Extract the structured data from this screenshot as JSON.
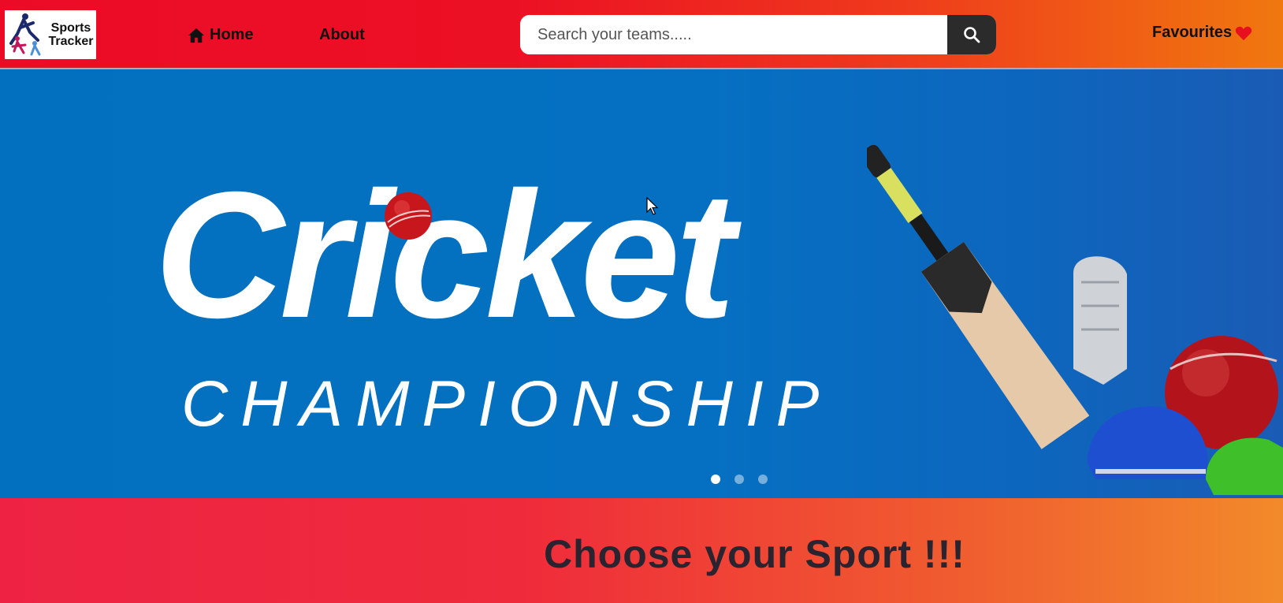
{
  "navbar": {
    "logo_line1": "Sports",
    "logo_line2": "Tracker",
    "home_label": "Home",
    "about_label": "About",
    "search_placeholder": "Search your teams.....",
    "favourites_label": "Favourites",
    "colors": {
      "gradient_start": "#ec0b27",
      "gradient_end": "#f0780f",
      "search_button": "#2b2b2b",
      "heart": "#e8101e"
    }
  },
  "banner": {
    "title": "Cricket",
    "subtitle": "CHAMPIONSHIP",
    "slides": 3,
    "active_slide": 1,
    "background": "#0370bf"
  },
  "section": {
    "heading": "Choose your Sport !!!"
  },
  "icons": [
    "home-icon",
    "search-icon",
    "heart-icon",
    "cursor-icon"
  ]
}
